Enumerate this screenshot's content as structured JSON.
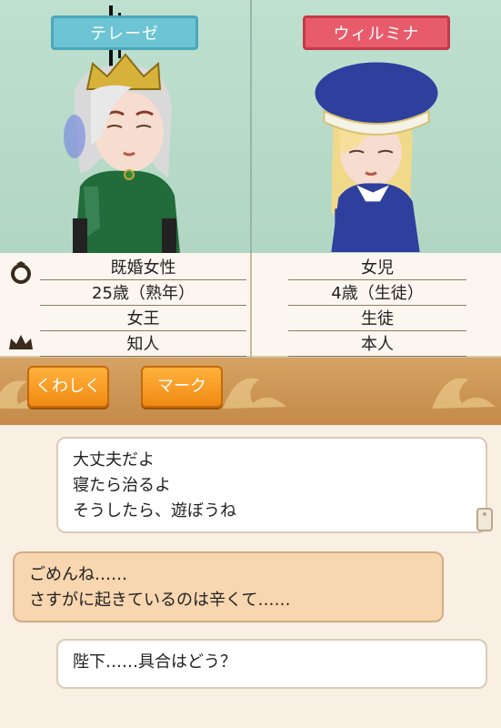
{
  "characters": {
    "left": {
      "name": "テレーゼ",
      "tag_color": "#6cc4d4"
    },
    "right": {
      "name": "ウィルミナ",
      "tag_color": "#e85b6a"
    }
  },
  "info": {
    "left": {
      "marital": "既婚女性",
      "age": "25歳（熟年）",
      "role": "女王",
      "relation": "知人"
    },
    "right": {
      "marital": "女児",
      "age": "4歳（生徒）",
      "role": "生徒",
      "relation": "本人"
    }
  },
  "icons": {
    "ring": "ring-icon",
    "crown": "crown-icon"
  },
  "buttons": {
    "detail": "くわしく",
    "mark": "マーク"
  },
  "messages": [
    {
      "speaker": "right",
      "text": "大丈夫だよ\n寝たら治るよ\nそうしたら、遊ぼうね"
    },
    {
      "speaker": "left",
      "text": "ごめんね……\nさすがに起きているのは辛くて……"
    },
    {
      "speaker": "right",
      "text": "陛下……具合はどう？"
    }
  ]
}
